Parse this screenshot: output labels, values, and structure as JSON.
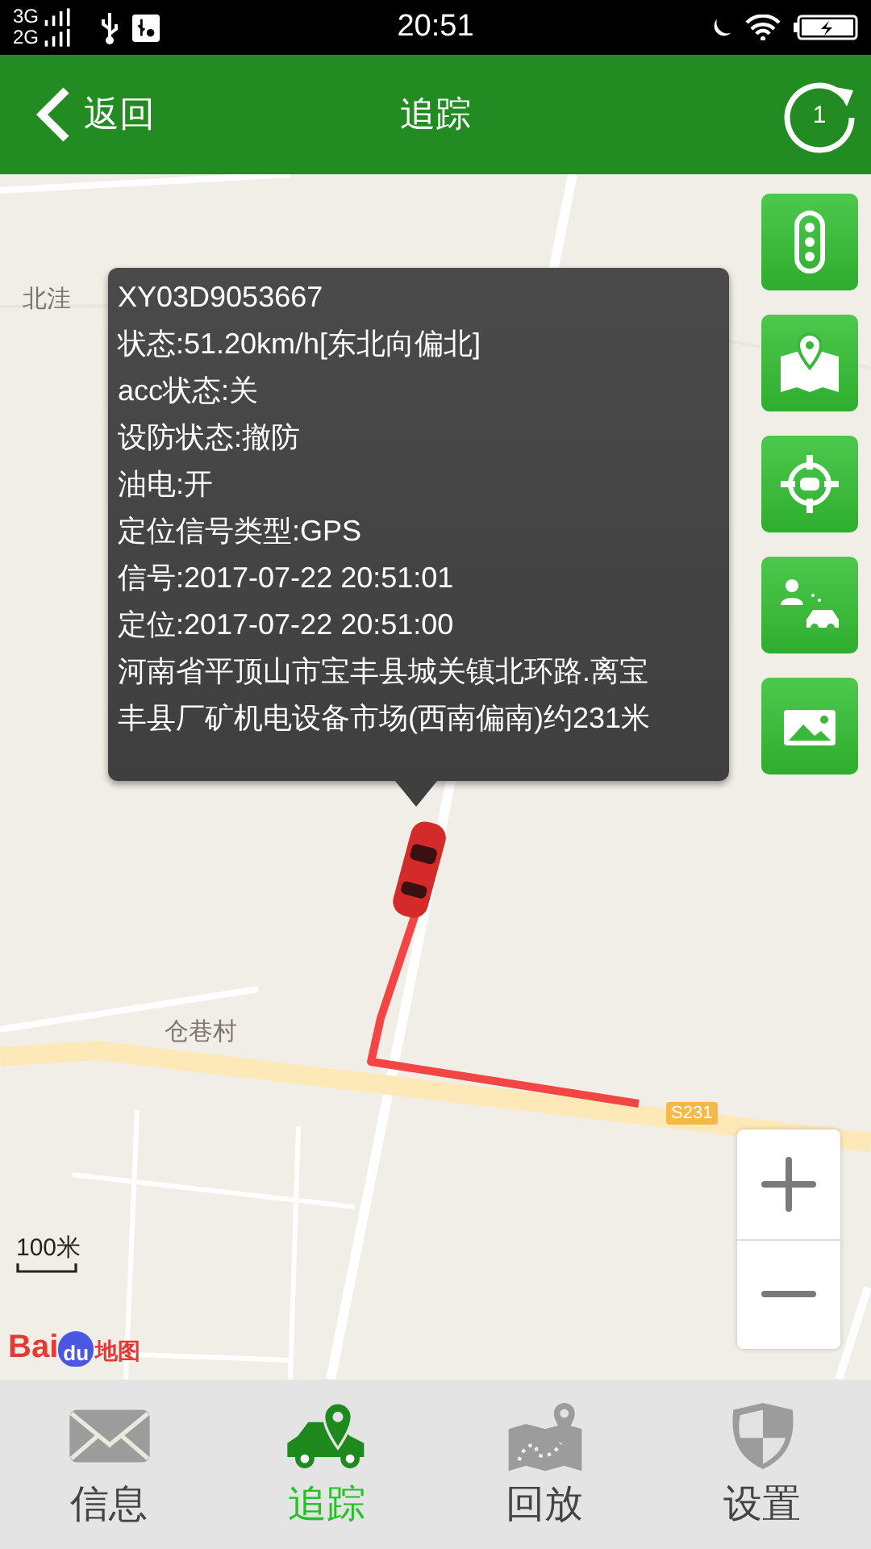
{
  "status_bar": {
    "network_top": "3G",
    "network_bottom": "2G",
    "time": "20:51"
  },
  "header": {
    "back_label": "返回",
    "title": "追踪",
    "refresh_count": "1"
  },
  "map": {
    "labels": [
      {
        "text": "北洼"
      },
      {
        "text": "仓巷村"
      }
    ],
    "road_shield": "S231",
    "scale": "100米",
    "logo": {
      "left": "Bai",
      "middle": "du",
      "right": "地图"
    }
  },
  "popup": {
    "lines": [
      "XY03D9053667",
      "状态:51.20km/h[东北向偏北]",
      "acc状态:关",
      "设防状态:撤防",
      "油电:开",
      "定位信号类型:GPS",
      "信号:2017-07-22 20:51:01",
      "定位:2017-07-22 20:51:00",
      "河南省平顶山市宝丰县城关镇北环路.离宝丰县厂矿机电设备市场(西南偏南)约231米"
    ]
  },
  "side_buttons": [
    {
      "kind": "traffic"
    },
    {
      "kind": "map"
    },
    {
      "kind": "locate"
    },
    {
      "kind": "person_car"
    },
    {
      "kind": "picture"
    }
  ],
  "tabs": [
    {
      "label": "信息",
      "selected": false
    },
    {
      "label": "追踪",
      "selected": true
    },
    {
      "label": "回放",
      "selected": false
    },
    {
      "label": "设置",
      "selected": false
    }
  ]
}
